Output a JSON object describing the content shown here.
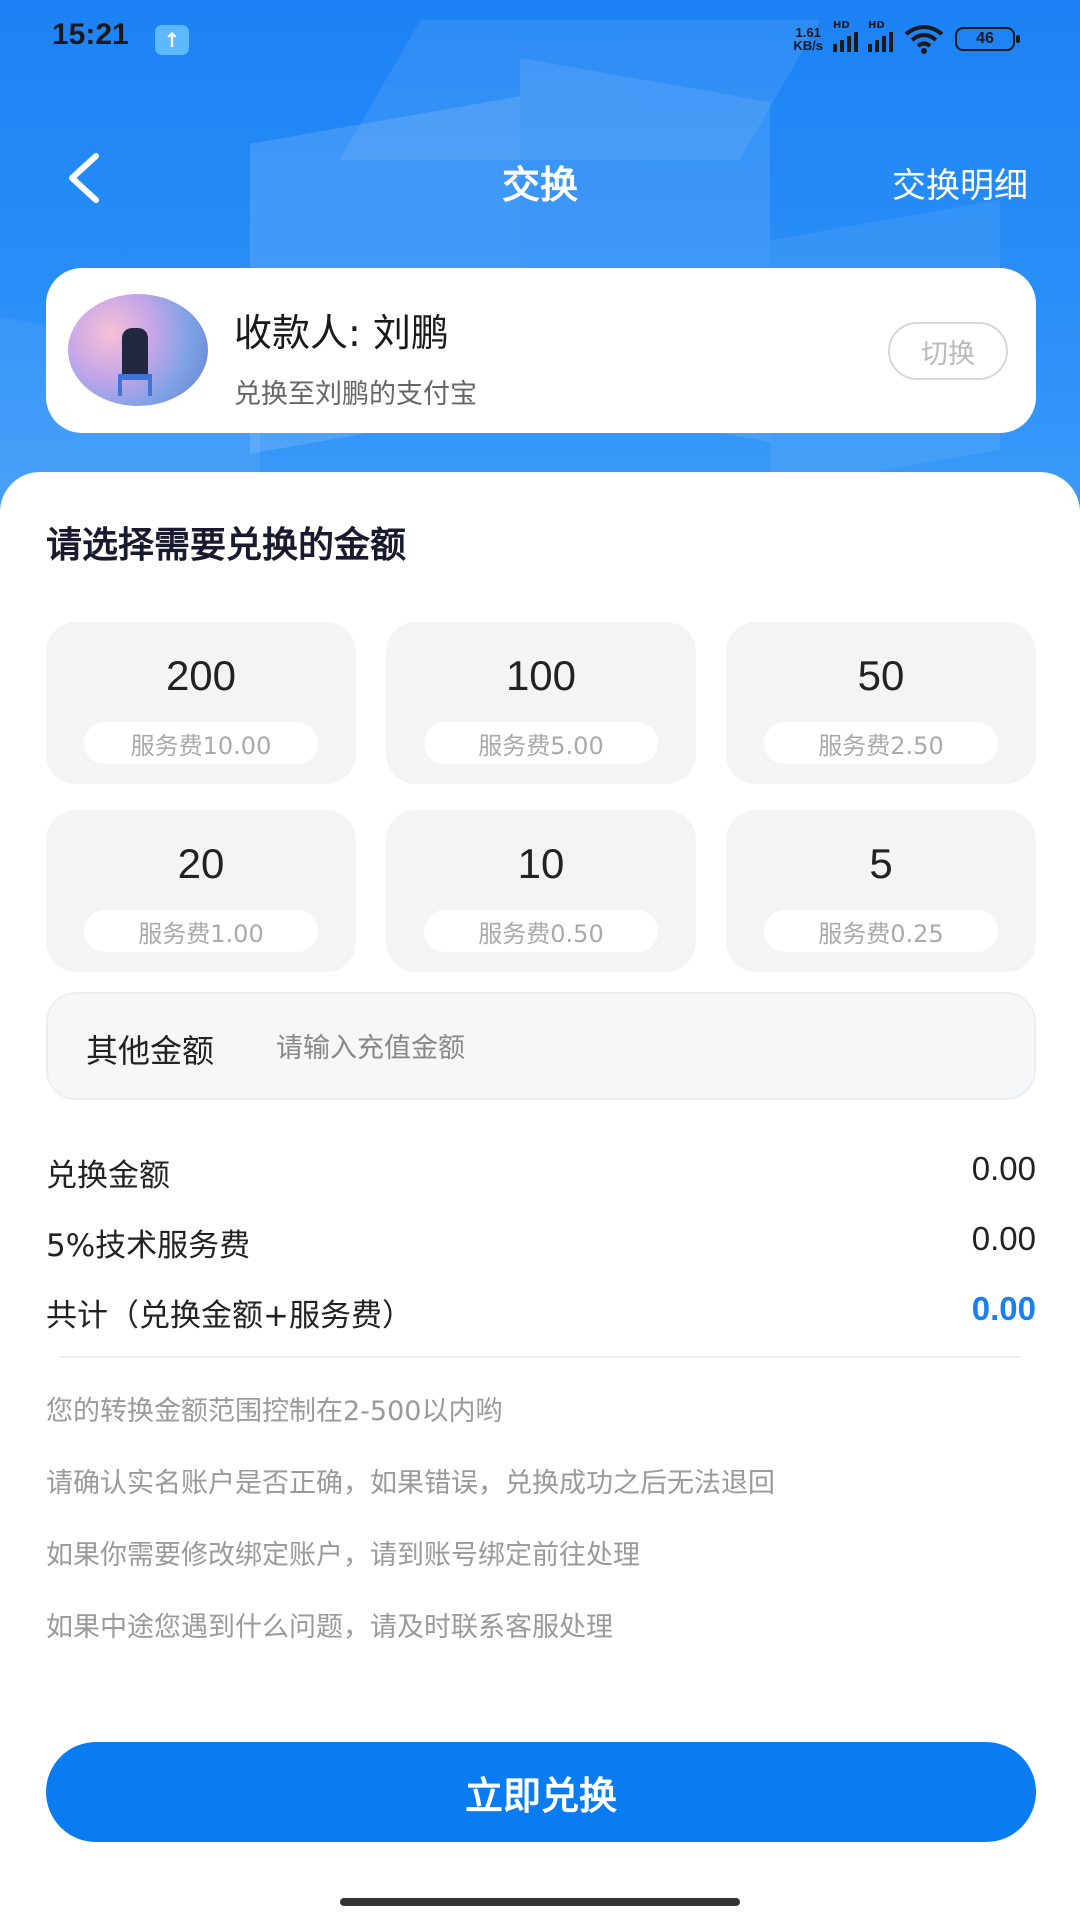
{
  "status_bar": {
    "time": "15:21",
    "network_speed_value": "1.61",
    "network_speed_unit": "KB/s",
    "sim1_badge": "HD",
    "sim2_badge": "HD",
    "battery": "46"
  },
  "nav": {
    "title": "交换",
    "detail_link": "交换明细"
  },
  "payee": {
    "name": "收款人: 刘鹏",
    "subtitle": "兑换至刘鹏的支付宝",
    "switch_label": "切换"
  },
  "amount_section": {
    "heading": "请选择需要兑换的金额",
    "options": [
      {
        "amount": "200",
        "fee": "服务费10.00"
      },
      {
        "amount": "100",
        "fee": "服务费5.00"
      },
      {
        "amount": "50",
        "fee": "服务费2.50"
      },
      {
        "amount": "20",
        "fee": "服务费1.00"
      },
      {
        "amount": "10",
        "fee": "服务费0.50"
      },
      {
        "amount": "5",
        "fee": "服务费0.25"
      }
    ],
    "other_label": "其他金额",
    "other_placeholder": "请输入充值金额",
    "other_value": ""
  },
  "summary": {
    "exchange_label": "兑换金额",
    "exchange_value": "0.00",
    "fee_label": "5%技术服务费",
    "fee_value": "0.00",
    "total_label": "共计（兑换金额+服务费）",
    "total_value": "0.00"
  },
  "notes": [
    "您的转换金额范围控制在2-500以内哟",
    "请确认实名账户是否正确，如果错误，兑换成功之后无法退回",
    "如果你需要修改绑定账户，请到账号绑定前往处理",
    "如果中途您遇到什么问题，请及时联系客服处理"
  ],
  "cta_label": "立即兑换",
  "colors": {
    "primary": "#0a7cf2",
    "header_blue": "#1c82f5",
    "total_value": "#1b7ff0"
  }
}
